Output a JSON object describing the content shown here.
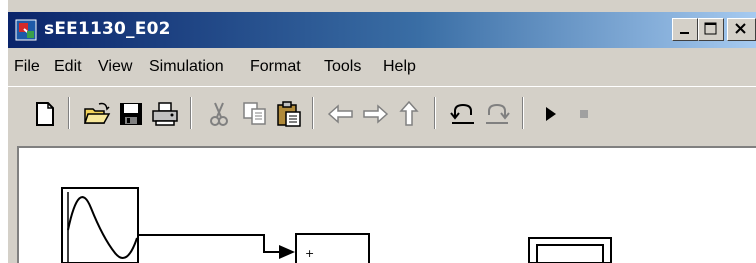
{
  "window": {
    "title": "sEE1130_E02",
    "buttons": {
      "minimize_icon": "minimize-icon",
      "maximize_icon": "maximize-icon",
      "close_icon": "close-icon"
    }
  },
  "menu": {
    "items": [
      "File",
      "Edit",
      "View",
      "Simulation",
      "Format",
      "Tools",
      "Help"
    ]
  },
  "toolbar": {
    "icons": [
      "new-model-icon",
      "open-folder-icon",
      "save-icon",
      "print-icon",
      "cut-icon",
      "copy-icon",
      "paste-icon",
      "back-arrow-icon",
      "forward-arrow-icon",
      "up-arrow-icon",
      "undo-icon",
      "redo-icon",
      "start-simulation-icon",
      "stop-simulation-icon"
    ]
  },
  "diagram": {
    "blocks": [
      "sine-wave-source",
      "sum-block",
      "scope-block"
    ],
    "sum_sign": "+"
  },
  "colors": {
    "title_bar_start": "#0a246a",
    "title_bar_end": "#a6caf0",
    "chrome": "#d4d0c8",
    "canvas": "#ffffff"
  }
}
